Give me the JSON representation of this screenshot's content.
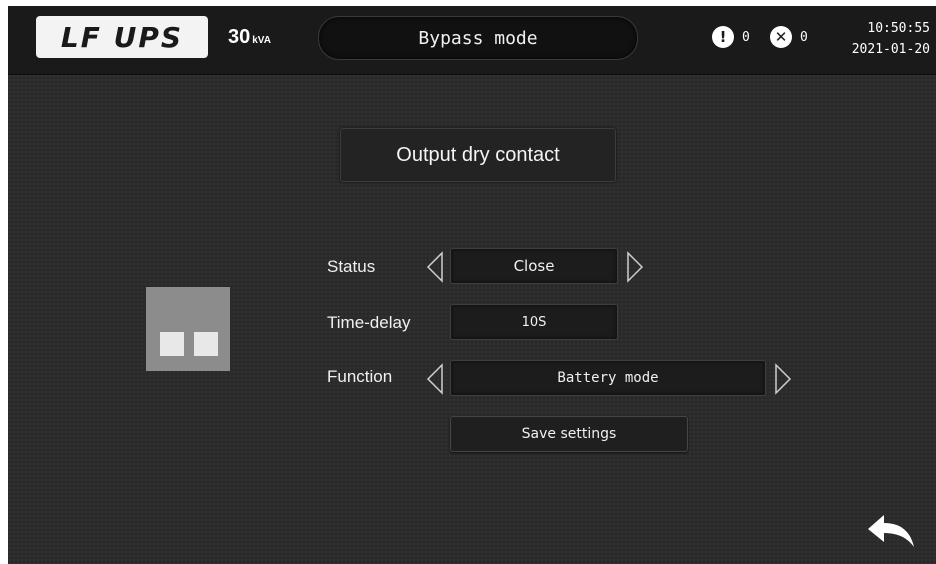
{
  "header": {
    "brand": "LF UPS",
    "rating_value": "30",
    "rating_unit": "kVA",
    "mode": "Bypass mode",
    "warning_icon": "exclamation-icon",
    "warning_count": "0",
    "fault_icon": "x-circle-icon",
    "fault_count": "0",
    "time": "10:50:55",
    "date": "2021-01-20"
  },
  "page": {
    "title": "Output dry contact",
    "contact_icon": "dry-contact-icon"
  },
  "form": {
    "status_label": "Status",
    "status_value": "Close",
    "delay_label": "Time-delay",
    "delay_value": "10S",
    "function_label": "Function",
    "function_value": "Battery mode",
    "save_label": "Save settings"
  },
  "nav": {
    "back_icon": "back-arrow-icon"
  },
  "colors": {
    "background": "#2a2a2a",
    "topbar": "#1a1a1a",
    "text": "#f0f0f0",
    "icon_tile": "#8c8c8c"
  }
}
